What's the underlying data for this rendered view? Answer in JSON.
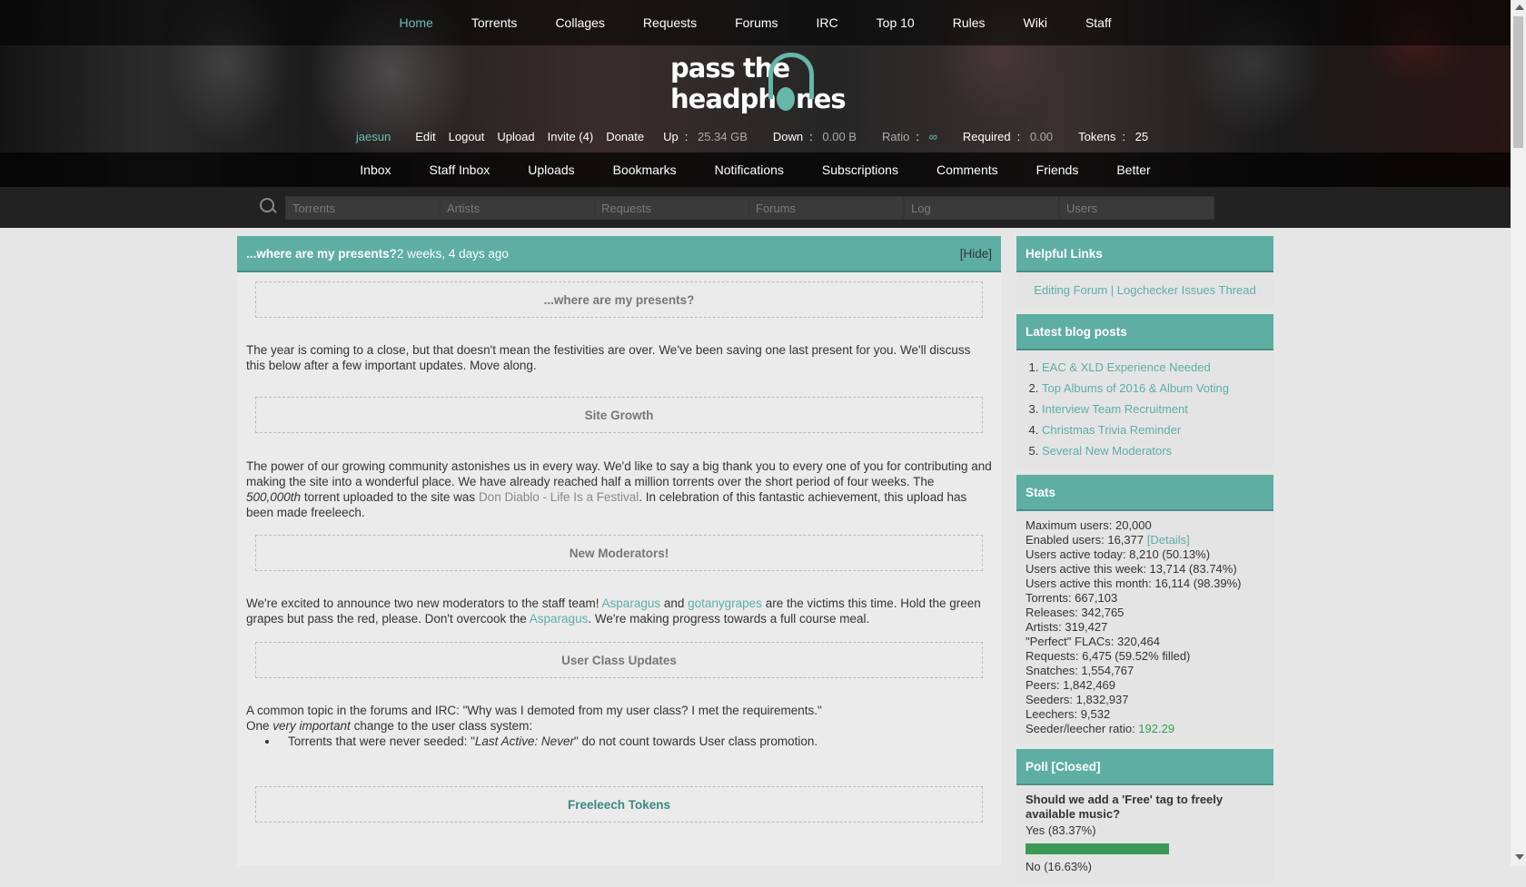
{
  "nav": {
    "items": [
      "Home",
      "Torrents",
      "Collages",
      "Requests",
      "Forums",
      "IRC",
      "Top 10",
      "Rules",
      "Wiki",
      "Staff"
    ]
  },
  "logo": {
    "line1": "pass the",
    "line2a": "headph",
    "line2b": "nes"
  },
  "userbar": {
    "username": "jaesun",
    "edit": "Edit",
    "logout": "Logout",
    "upload": "Upload",
    "invite": "Invite (4)",
    "donate": "Donate",
    "up_label": "Up",
    "up_value": "25.34 GB",
    "down_label": "Down",
    "down_value": "0.00 B",
    "ratio_label": "Ratio",
    "ratio_value": "∞",
    "required_label": "Required",
    "required_value": "0.00",
    "tokens_label": "Tokens",
    "tokens_value": "25"
  },
  "subnav": {
    "items": [
      "Inbox",
      "Staff Inbox",
      "Uploads",
      "Bookmarks",
      "Notifications",
      "Subscriptions",
      "Comments",
      "Friends",
      "Better"
    ]
  },
  "search": {
    "torrents": "Torrents",
    "artists": "Artists",
    "requests": "Requests",
    "forums": "Forums",
    "log": "Log",
    "users": "Users"
  },
  "news": {
    "title": "...where are my presents?",
    "age": " 2 weeks, 4 days ago",
    "hide": "[Hide]",
    "s1": "...where are my presents?",
    "p1": "The year is coming to a close, but that doesn't mean the festivities are over. We've been saving one last present for you. We'll discuss this below after a few important updates. Move along.",
    "s2": "Site Growth",
    "p2a": "The power of our growing community astonishes us in every way. We'd like to say a big thank you to every one of you for contributing and making the site into a wonderful place. We have already reached half a million torrents over the short period of four weeks. The ",
    "p2b": "500,000th",
    "p2c": " torrent uploaded to the site was ",
    "p2link": "Don Diablo - Life Is a Festival",
    "p2d": ". In celebration of this fantastic achievement, this upload has been made freeleech.",
    "s3": "New Moderators!",
    "p3a": "We're excited to announce two new moderators to the staff team! ",
    "p3l1": "Asparagus",
    "p3b": " and ",
    "p3l2": "gotanygrapes",
    "p3c": " are the victims this time. Hold the green grapes but pass the red, please. Don't overcook the ",
    "p3l3": "Asparagus",
    "p3d": ". We're making progress towards a full course meal.",
    "s4": "User Class Updates",
    "p4a": "A common topic in the forums and IRC: \"Why was I demoted from my user class? I met the requirements.\"",
    "p4b1": "One ",
    "p4b2": "very important",
    "p4b3": " change to the user class system:",
    "p4li1": "Torrents that were never seeded: \"",
    "p4li2": "Last Active: Never",
    "p4li3": "\" do not count towards User class promotion.",
    "s5": "Freeleech Tokens"
  },
  "sidebar": {
    "helpful": {
      "title": "Helpful Links",
      "link": "Editing Forum | Logchecker Issues Thread"
    },
    "blog": {
      "title": "Latest blog posts",
      "items": [
        "EAC & XLD Experience Needed",
        "Top Albums of 2016 & Album Voting",
        "Interview Team Recruitment",
        "Christmas Trivia Reminder",
        "Several New Moderators"
      ]
    },
    "stats": {
      "title": "Stats",
      "max": "Maximum users: 20,000",
      "enabled": "Enabled users: 16,377",
      "details": "[Details]",
      "today": "Users active today: 8,210 (50.13%)",
      "week": "Users active this week: 13,714 (83.74%)",
      "month": "Users active this month: 16,114 (98.39%)",
      "torrents": "Torrents: 667,103",
      "releases": "Releases: 342,765",
      "artists": "Artists: 319,427",
      "flacs": "\"Perfect\" FLACs: 320,464",
      "requests": "Requests: 6,475 (59.52% filled)",
      "snatches": "Snatches: 1,554,767",
      "peers": "Peers: 1,842,469",
      "seeders": "Seeders: 1,832,937",
      "leechers": "Leechers: 9,532",
      "ratio_label": "Seeder/leecher ratio: ",
      "ratio_value": "192.29"
    },
    "poll": {
      "title": "Poll [Closed]",
      "question": "Should we add a 'Free' tag to freely available music?",
      "yes": "Yes (83.37%)",
      "yes_fraction": 0.8337,
      "no": "No (16.63%)",
      "no_fraction": 0.1663,
      "bar_color": "#3a9a55"
    }
  },
  "colors": {
    "accent": "#5eaea3",
    "nav_active": "#6bbdb0"
  }
}
